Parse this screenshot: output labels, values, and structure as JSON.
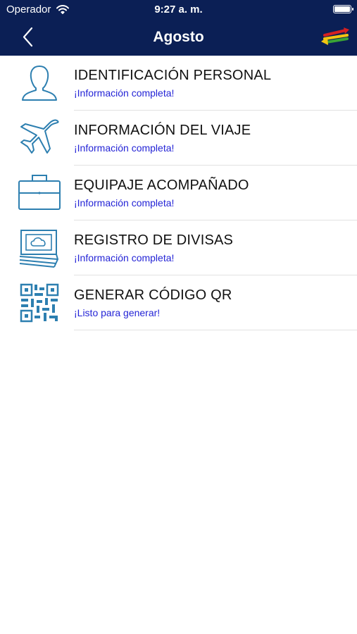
{
  "status_bar": {
    "carrier": "Operador",
    "time": "9:27 a. m."
  },
  "nav": {
    "title": "Agosto",
    "back_icon": "chevron-left-icon",
    "swap_icon": "swap-arrows-icon"
  },
  "colors": {
    "nav_background": "#0b1f55",
    "icon_stroke": "#2d7fb0",
    "subtitle_text": "#2424d6"
  },
  "items": [
    {
      "title": "IDENTIFICACIÓN PERSONAL",
      "subtitle": "¡Información completa!",
      "icon": "person-icon"
    },
    {
      "title": "INFORMACIÓN DEL VIAJE",
      "subtitle": "¡Información completa!",
      "icon": "airplane-icon"
    },
    {
      "title": "EQUIPAJE ACOMPAÑADO",
      "subtitle": "¡Información completa!",
      "icon": "briefcase-icon"
    },
    {
      "title": "REGISTRO DE DIVISAS",
      "subtitle": "¡Información completa!",
      "icon": "banknotes-icon"
    },
    {
      "title": "GENERAR CÓDIGO QR",
      "subtitle": "¡Listo para generar!",
      "icon": "qr-code-icon"
    }
  ]
}
